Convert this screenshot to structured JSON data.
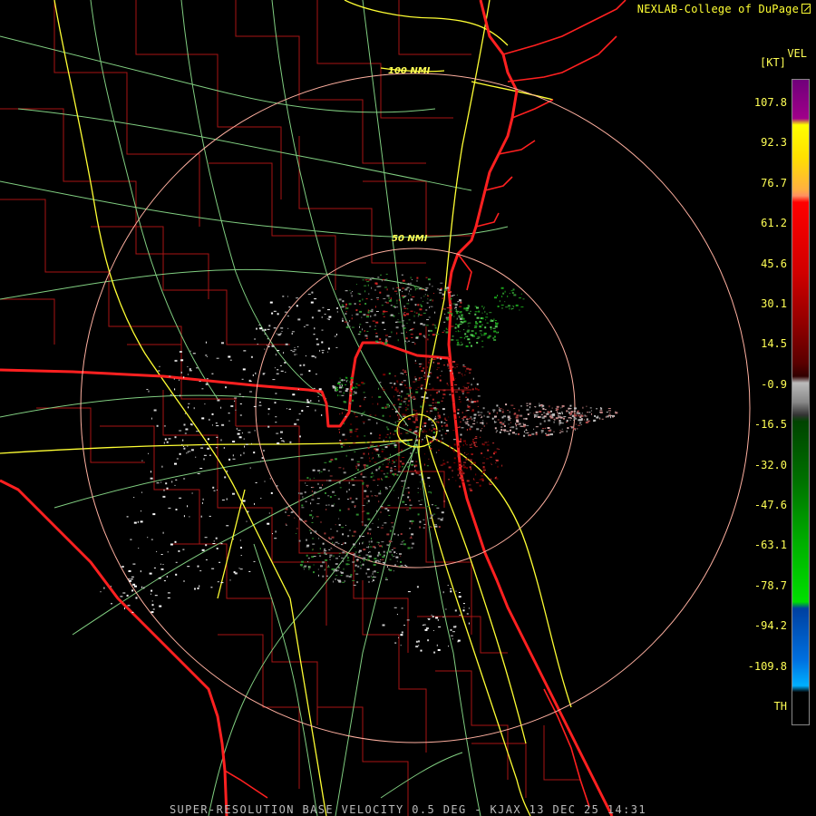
{
  "credit": "NEXLAB-College of DuPage",
  "ring_labels": [
    "100 NMI",
    "50 NMI"
  ],
  "legend": {
    "title": "VEL",
    "unit": "[KT]",
    "ticks": [
      "107.8",
      "92.3",
      "76.7",
      "61.2",
      "45.6",
      "30.1",
      "14.5",
      "-0.9",
      "-16.5",
      "-32.0",
      "-47.6",
      "-63.1",
      "-78.7",
      "-94.2",
      "-109.8",
      "TH"
    ]
  },
  "footer": "SUPER-RESOLUTION BASE VELOCITY 0.5 DEG - KJAX 13 DEC 25 14:31",
  "colors": {
    "state_border": "#ff2020",
    "county": "#b01818",
    "highway": "#ffff33",
    "road": "#90ee90",
    "range_ring": "#ffb0a0"
  }
}
